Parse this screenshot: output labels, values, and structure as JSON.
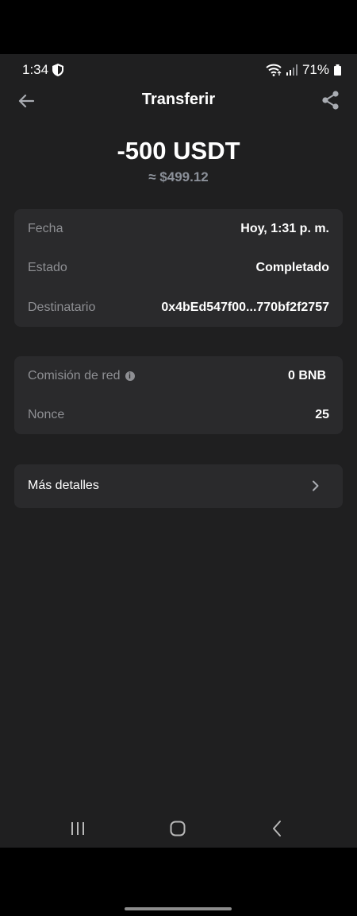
{
  "status_bar": {
    "time": "1:34",
    "battery": "71%"
  },
  "header": {
    "title": "Transferir"
  },
  "amount": {
    "value": "-500 USDT",
    "fiat": "≈ $499.12"
  },
  "details_card": {
    "rows": [
      {
        "label": "Fecha",
        "value": "Hoy, 1:31 p. m."
      },
      {
        "label": "Estado",
        "value": "Completado"
      },
      {
        "label": "Destinatario",
        "value": "0x4bEd547f00...770bf2f2757"
      }
    ]
  },
  "fee_card": {
    "rows": [
      {
        "label": "Comisión de red",
        "value": "0 BNB"
      },
      {
        "label": "Nonce",
        "value": "25"
      }
    ]
  },
  "more_details": {
    "label": "Más detalles"
  },
  "icons": {
    "back": "arrow-left-icon",
    "share": "share-icon",
    "info": "info-icon",
    "chevron": "chevron-right-icon",
    "recents": "recents-icon",
    "home": "home-icon",
    "nav_back": "nav-back-icon"
  },
  "colors": {
    "background": "#1f1f20",
    "card": "#2a2a2c",
    "label": "#8e8f93",
    "value": "#ffffff",
    "fiat": "#8b9099"
  }
}
